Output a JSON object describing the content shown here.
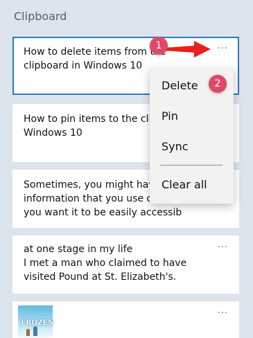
{
  "panel": {
    "title": "Clipboard"
  },
  "items": [
    {
      "lines": [
        "How to delete items from the",
        "clipboard in Windows 10"
      ],
      "more": "···",
      "selected": true
    },
    {
      "lines": [
        "How to pin items to the clip",
        "Windows 10"
      ],
      "more": "···"
    },
    {
      "lines": [
        "Sometimes, you might have",
        "information that you use of",
        "you want it to be easily accessib"
      ],
      "more": "···"
    },
    {
      "lines": [
        "at one stage in my life",
        "I met a man who claimed to have",
        "visited Pound at St. Elizabeth's."
      ],
      "more": "···"
    },
    {
      "image_title": "FROZEN",
      "more": "···"
    }
  ],
  "context_menu": {
    "items": [
      "Delete",
      "Pin",
      "Sync",
      "Clear all"
    ]
  },
  "annotations": {
    "badge_1": "1",
    "badge_2": "2",
    "badge_color": "#e0486a",
    "arrow_color": "#e8211d"
  },
  "colors": {
    "background": "#dde4ec",
    "selected_border": "#2b78c5",
    "card": "#ffffff",
    "menu": "#f2f2f2"
  }
}
